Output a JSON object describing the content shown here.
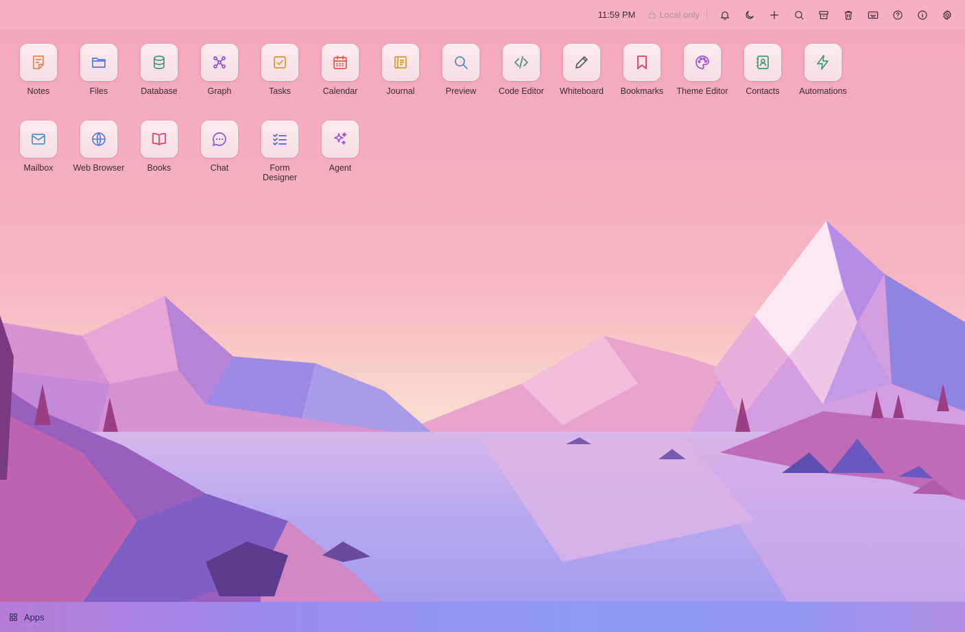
{
  "topbar": {
    "clock": "11:59 PM",
    "sync_status": "Local only",
    "icons": [
      "bell-icon",
      "moon-icon",
      "plus-icon",
      "search-icon",
      "archive-icon",
      "trash-icon",
      "keyboard-icon",
      "help-icon",
      "info-icon",
      "gear-icon"
    ]
  },
  "apps": [
    {
      "label": "Notes",
      "icon": "notes-icon",
      "color": "#e7834f"
    },
    {
      "label": "Files",
      "icon": "folder-icon",
      "color": "#4f79e0"
    },
    {
      "label": "Database",
      "icon": "database-icon",
      "color": "#3e9a6c"
    },
    {
      "label": "Graph",
      "icon": "graph-icon",
      "color": "#8c4fd8"
    },
    {
      "label": "Tasks",
      "icon": "task-check-icon",
      "color": "#d9962c"
    },
    {
      "label": "Calendar",
      "icon": "calendar-icon",
      "color": "#e1553e"
    },
    {
      "label": "Journal",
      "icon": "journal-icon",
      "color": "#d9962c"
    },
    {
      "label": "Preview",
      "icon": "magnifier-icon",
      "color": "#5a86b8"
    },
    {
      "label": "Code Editor",
      "icon": "code-icon",
      "color": "#4b8e78"
    },
    {
      "label": "Whiteboard",
      "icon": "pencil-icon",
      "color": "#5a5a66"
    },
    {
      "label": "Bookmarks",
      "icon": "bookmark-icon",
      "color": "#e04060"
    },
    {
      "label": "Theme Editor",
      "icon": "palette-icon",
      "color": "#9c4fd8"
    },
    {
      "label": "Contacts",
      "icon": "contacts-icon",
      "color": "#3e9a6c"
    },
    {
      "label": "Automations",
      "icon": "lightning-icon",
      "color": "#3e9a6c"
    },
    {
      "label": "Mailbox",
      "icon": "mail-icon",
      "color": "#4a90b8"
    },
    {
      "label": "Web Browser",
      "icon": "globe-icon",
      "color": "#4f79e0"
    },
    {
      "label": "Books",
      "icon": "book-icon",
      "color": "#e04060"
    },
    {
      "label": "Chat",
      "icon": "chat-icon",
      "color": "#8c4fd8"
    },
    {
      "label": "Form Designer",
      "icon": "checklist-icon",
      "color": "#4f5fd0"
    },
    {
      "label": "Agent",
      "icon": "sparkles-icon",
      "color": "#9c4fd8"
    }
  ],
  "taskbar": {
    "apps_label": "Apps"
  }
}
